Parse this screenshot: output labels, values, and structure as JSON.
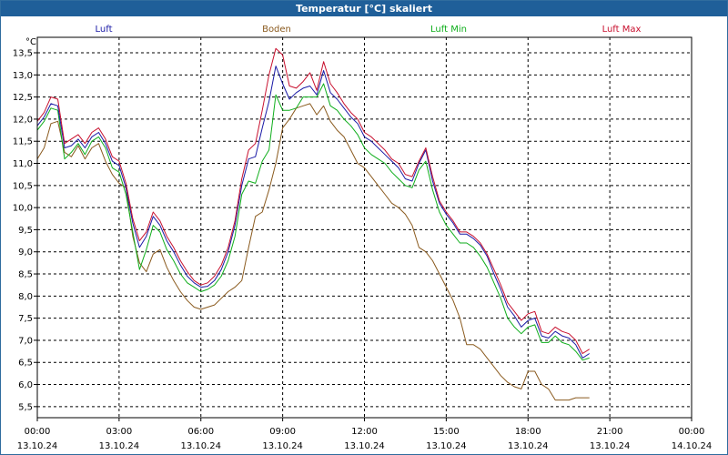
{
  "window": {
    "title": "Temperatur [°C] skaliert"
  },
  "chart_data": {
    "type": "line",
    "title": "Temperatur [°C] skaliert",
    "ylabel": "°C",
    "xlabel": "",
    "ylim": [
      5.25,
      13.85
    ],
    "xlim": [
      0,
      24
    ],
    "grid": true,
    "legend_position": "top",
    "y_ticks": [
      "5,5",
      "6,0",
      "6,5",
      "7,0",
      "7,5",
      "8,0",
      "8,5",
      "9,0",
      "9,5",
      "10,0",
      "10,5",
      "11,0",
      "11,5",
      "12,0",
      "12,5",
      "13,0",
      "13,5"
    ],
    "x_ticks": [
      {
        "time": "00:00",
        "date": "13.10.24"
      },
      {
        "time": "03:00",
        "date": "13.10.24"
      },
      {
        "time": "06:00",
        "date": "13.10.24"
      },
      {
        "time": "09:00",
        "date": "13.10.24"
      },
      {
        "time": "12:00",
        "date": "13.10.24"
      },
      {
        "time": "15:00",
        "date": "13.10.24"
      },
      {
        "time": "18:00",
        "date": "13.10.24"
      },
      {
        "time": "21:00",
        "date": "13.10.24"
      },
      {
        "time": "00:00",
        "date": "14.10.24"
      }
    ],
    "x_hours": [
      0,
      0.25,
      0.5,
      0.75,
      1,
      1.25,
      1.5,
      1.75,
      2,
      2.25,
      2.5,
      2.75,
      3,
      3.25,
      3.5,
      3.75,
      4,
      4.25,
      4.5,
      4.75,
      5,
      5.25,
      5.5,
      5.75,
      6,
      6.25,
      6.5,
      6.75,
      7,
      7.25,
      7.5,
      7.75,
      8,
      8.25,
      8.5,
      8.75,
      9,
      9.25,
      9.5,
      9.75,
      10,
      10.25,
      10.5,
      10.75,
      11,
      11.25,
      11.5,
      11.75,
      12,
      12.25,
      12.5,
      12.75,
      13,
      13.25,
      13.5,
      13.75,
      14,
      14.25,
      14.5,
      14.75,
      15,
      15.25,
      15.5,
      15.75,
      16,
      16.25,
      16.5,
      16.75,
      17,
      17.25,
      17.5,
      17.75,
      18,
      18.25,
      18.5,
      18.75,
      19,
      19.25,
      19.5,
      19.75,
      20,
      20.25,
      20.5,
      20.75,
      21,
      21.25,
      21.5,
      21.75,
      22,
      22.25,
      22.5,
      22.75,
      23,
      23.25,
      23.5,
      23.75,
      24
    ],
    "series": [
      {
        "name": "Luft",
        "color": "#1a1aa6",
        "values": [
          11.85,
          12.05,
          12.35,
          12.3,
          11.35,
          11.4,
          11.55,
          11.35,
          11.6,
          11.7,
          11.45,
          11.05,
          10.95,
          10.45,
          9.65,
          9.1,
          9.35,
          9.8,
          9.6,
          9.25,
          9.0,
          8.7,
          8.45,
          8.3,
          8.2,
          8.22,
          8.35,
          8.6,
          9.0,
          9.6,
          10.5,
          11.1,
          11.15,
          11.8,
          12.4,
          13.2,
          12.8,
          12.45,
          12.6,
          12.7,
          12.75,
          12.55,
          13.1,
          12.6,
          12.45,
          12.25,
          12.05,
          11.9,
          11.6,
          11.5,
          11.35,
          11.2,
          11.05,
          10.9,
          10.65,
          10.6,
          11.0,
          11.3,
          10.6,
          10.1,
          9.85,
          9.65,
          9.4,
          9.4,
          9.3,
          9.15,
          8.9,
          8.5,
          8.15,
          7.75,
          7.55,
          7.3,
          7.45,
          7.5,
          7.1,
          7.05,
          7.2,
          7.1,
          7.05,
          6.9,
          6.6,
          6.7
        ]
      },
      {
        "name": "Boden",
        "color": "#8a5a1e",
        "values": [
          11.1,
          11.35,
          11.9,
          11.95,
          11.25,
          11.15,
          11.4,
          11.1,
          11.35,
          11.45,
          11.05,
          10.75,
          10.55,
          10.45,
          9.35,
          8.75,
          8.55,
          8.95,
          9.05,
          8.65,
          8.35,
          8.1,
          7.9,
          7.75,
          7.7,
          7.75,
          7.8,
          7.95,
          8.1,
          8.2,
          8.35,
          9.1,
          9.8,
          9.9,
          10.4,
          11.0,
          11.8,
          12.0,
          12.25,
          12.3,
          12.35,
          12.1,
          12.3,
          11.95,
          11.75,
          11.6,
          11.3,
          11.0,
          10.9,
          10.7,
          10.5,
          10.3,
          10.1,
          10.0,
          9.85,
          9.6,
          9.1,
          9.0,
          8.8,
          8.5,
          8.2,
          7.9,
          7.5,
          6.9,
          6.9,
          6.8,
          6.6,
          6.4,
          6.2,
          6.05,
          5.95,
          5.9,
          6.3,
          6.3,
          6.0,
          5.9,
          5.65,
          5.65,
          5.65,
          5.7,
          5.7,
          5.7
        ]
      },
      {
        "name": "Luft Min",
        "color": "#0fae1c",
        "values": [
          11.75,
          11.95,
          12.25,
          12.2,
          11.1,
          11.25,
          11.45,
          11.2,
          11.5,
          11.6,
          11.35,
          10.9,
          10.8,
          10.3,
          9.45,
          8.6,
          9.05,
          9.6,
          9.45,
          9.05,
          8.8,
          8.5,
          8.3,
          8.2,
          8.1,
          8.15,
          8.25,
          8.45,
          8.8,
          9.35,
          10.3,
          10.6,
          10.55,
          11.05,
          11.3,
          12.55,
          12.2,
          12.2,
          12.25,
          12.5,
          12.5,
          12.5,
          12.8,
          12.3,
          12.2,
          12.0,
          11.85,
          11.65,
          11.35,
          11.2,
          11.1,
          11.0,
          10.8,
          10.65,
          10.5,
          10.45,
          10.85,
          11.05,
          10.4,
          9.9,
          9.6,
          9.4,
          9.2,
          9.2,
          9.1,
          8.9,
          8.65,
          8.3,
          7.95,
          7.5,
          7.3,
          7.15,
          7.3,
          7.35,
          6.95,
          6.95,
          7.1,
          6.95,
          6.9,
          6.75,
          6.55,
          6.6
        ]
      },
      {
        "name": "Luft Max",
        "color": "#c8102e",
        "values": [
          11.95,
          12.15,
          12.5,
          12.45,
          11.45,
          11.55,
          11.65,
          11.45,
          11.7,
          11.8,
          11.55,
          11.15,
          11.05,
          10.55,
          9.75,
          9.25,
          9.45,
          9.9,
          9.7,
          9.35,
          9.1,
          8.8,
          8.55,
          8.35,
          8.25,
          8.3,
          8.45,
          8.7,
          9.1,
          9.7,
          10.65,
          11.3,
          11.45,
          12.2,
          13.0,
          13.6,
          13.45,
          12.75,
          12.7,
          12.85,
          13.05,
          12.65,
          13.3,
          12.8,
          12.6,
          12.35,
          12.15,
          12.0,
          11.7,
          11.6,
          11.45,
          11.3,
          11.1,
          11.0,
          10.75,
          10.7,
          11.05,
          11.35,
          10.7,
          10.15,
          9.9,
          9.7,
          9.45,
          9.45,
          9.35,
          9.2,
          8.95,
          8.6,
          8.25,
          7.85,
          7.65,
          7.45,
          7.6,
          7.65,
          7.2,
          7.15,
          7.3,
          7.2,
          7.15,
          7.0,
          6.7,
          6.8
        ]
      }
    ]
  }
}
